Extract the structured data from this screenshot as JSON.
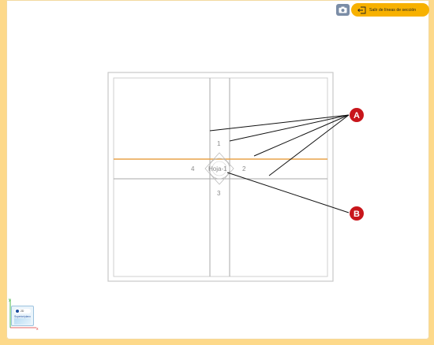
{
  "toolbar": {
    "camera_icon": "camera-icon",
    "exit_label": "Salir de líneas de sección",
    "exit_icon": "exit-door-icon"
  },
  "drawing": {
    "sheet_label": "Hoja-1",
    "section_numbers": [
      "1",
      "2",
      "3",
      "4"
    ],
    "callouts": [
      "A",
      "B"
    ],
    "colors": {
      "section_line_active": "#e8a34a",
      "section_line": "#a8a8a8",
      "callout": "#c8151b"
    }
  },
  "view_thumbnail": {
    "toggle_label": "2D",
    "plane_label": "Superior/plano",
    "axis_x": "x",
    "axis_y": "y"
  }
}
